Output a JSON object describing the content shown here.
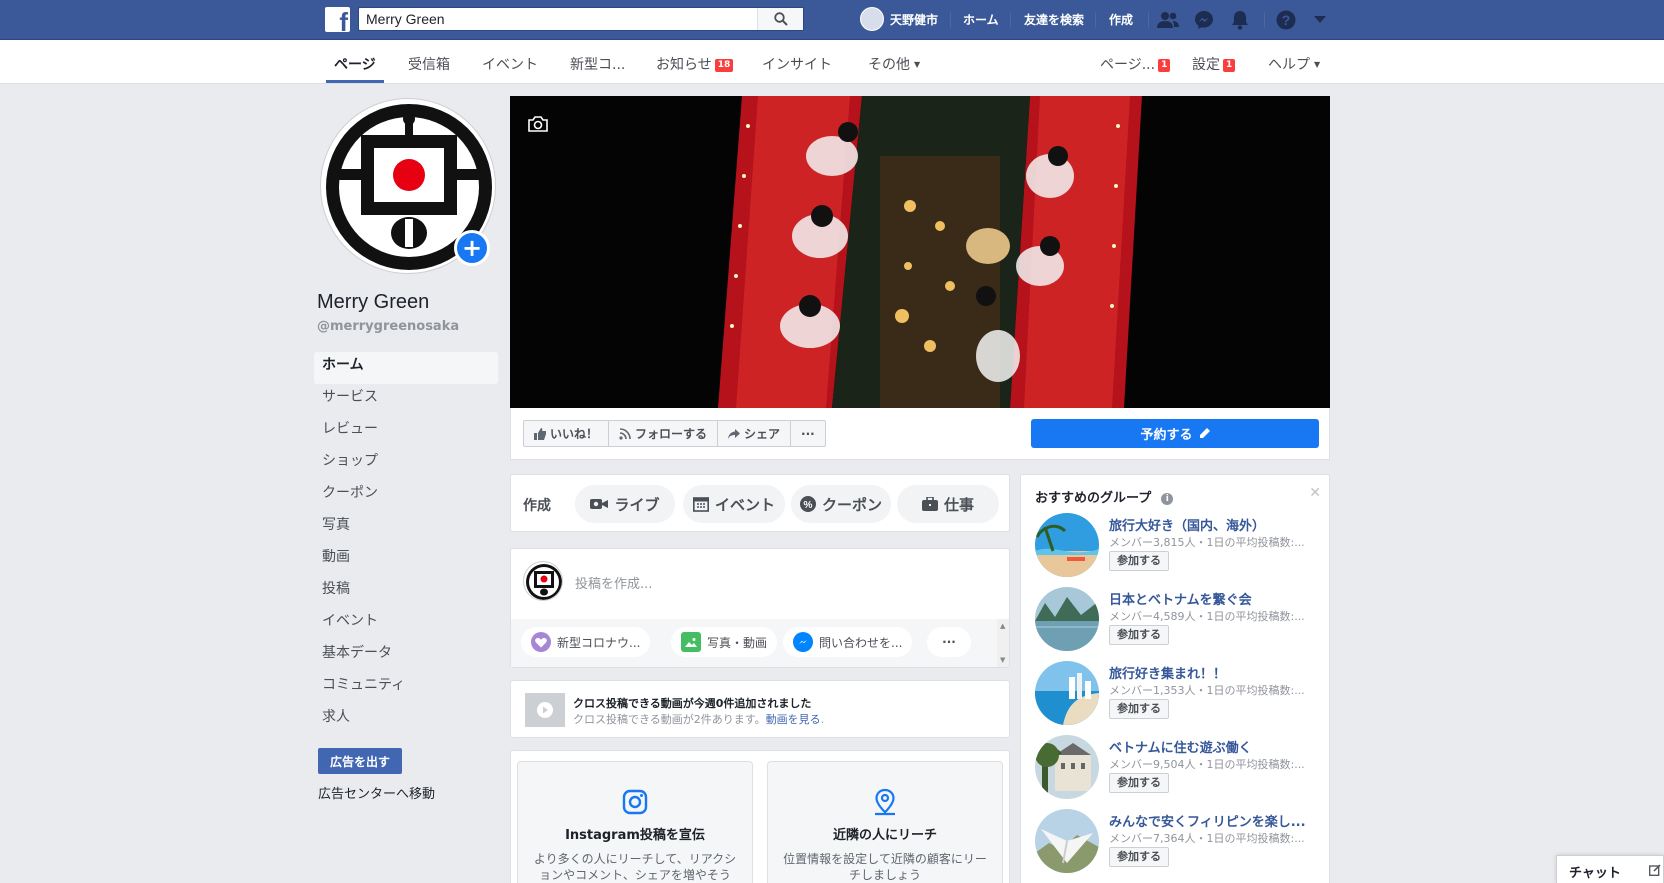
{
  "topbar": {
    "search_value": "Merry Green",
    "user_name": "天野健市",
    "links": {
      "home": "ホーム",
      "find_friends": "友達を検索",
      "create": "作成"
    }
  },
  "pagenav": {
    "items": [
      {
        "label": "ページ",
        "active": true
      },
      {
        "label": "受信箱"
      },
      {
        "label": "イベント"
      },
      {
        "label": "新型コ..."
      },
      {
        "label": "お知らせ",
        "badge": "18"
      },
      {
        "label": "インサイト"
      },
      {
        "label": "その他"
      }
    ],
    "right": [
      {
        "label": "ページ...",
        "badge": "1"
      },
      {
        "label": "設定",
        "badge": "1"
      },
      {
        "label": "ヘルプ"
      }
    ]
  },
  "profile": {
    "name": "Merry Green",
    "handle": "@merrygreenosaka"
  },
  "left_nav": [
    "ホーム",
    "サービス",
    "レビュー",
    "ショップ",
    "クーポン",
    "写真",
    "動画",
    "投稿",
    "イベント",
    "基本データ",
    "コミュニティ",
    "求人"
  ],
  "ads": {
    "button": "広告を出す",
    "link": "広告センターへ移動"
  },
  "action_bar": {
    "like": "いいね！",
    "follow": "フォローする",
    "share": "シェア",
    "more": "···",
    "reserve": "予約する"
  },
  "create": {
    "label": "作成",
    "live": "ライブ",
    "event": "イベント",
    "coupon": "クーポン",
    "job": "仕事"
  },
  "composer": {
    "placeholder": "投稿を作成...",
    "covid": "新型コロナウ...",
    "photo": "写真・動画",
    "contact": "問い合わせを...",
    "more": "···"
  },
  "crosspost": {
    "title": "クロス投稿できる動画が今週0件追加されました",
    "sub_prefix": "クロス投稿できる動画が2件あります。",
    "sub_link": "動画を見る",
    "sub_suffix": "."
  },
  "promos": [
    {
      "title": "Instagram投稿を宣伝",
      "desc": "より多くの人にリーチして、リアクションやコメント、シェアを増やそう"
    },
    {
      "title": "近隣の人にリーチ",
      "desc": "位置情報を設定して近隣の顧客にリーチしましょう"
    }
  ],
  "groups": {
    "title": "おすすめのグループ",
    "join_label": "参加する",
    "items": [
      {
        "name": "旅行大好き（国内、海外）",
        "meta": "メンバー3,815人・1日の平均投稿数:..."
      },
      {
        "name": "日本とベトナムを繋ぐ会",
        "meta": "メンバー4,589人・1日の平均投稿数:..."
      },
      {
        "name": "旅行好き集まれ！！",
        "meta": "メンバー1,353人・1日の平均投稿数:..."
      },
      {
        "name": "ベトナムに住む遊ぶ働く",
        "meta": "メンバー9,504人・1日の平均投稿数:..."
      },
      {
        "name": "みんなで安くフィリピンを楽し...",
        "meta": "メンバー7,364人・1日の平均投稿数:..."
      }
    ]
  },
  "chat": {
    "label": "チャット"
  },
  "colors": {
    "brand": "#3b5998",
    "accent": "#1877f2",
    "badge": "#fa3e3e"
  }
}
